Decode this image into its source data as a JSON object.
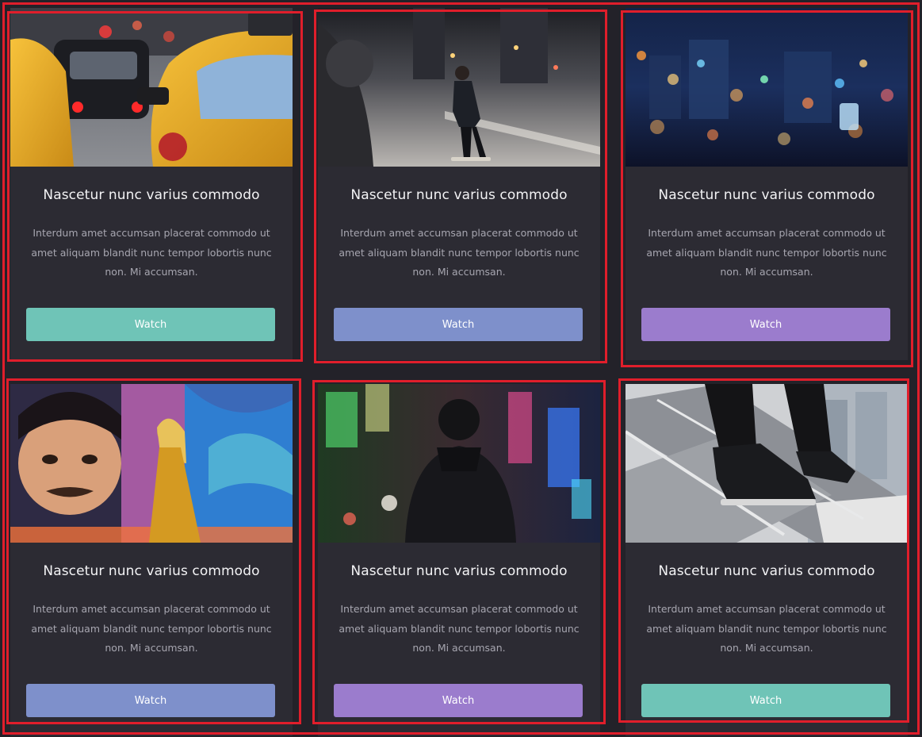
{
  "colors": {
    "background": "#232229",
    "card": "#2c2b33",
    "highlight_frame": "#e01e2b",
    "teal": "#6fc4b7",
    "blue": "#7e90cb",
    "purple": "#9b7ccd"
  },
  "cards": [
    {
      "image": "taxi-traffic-photo",
      "title": "Nascetur nunc varius commodo",
      "text": "Interdum amet accumsan placerat commodo ut amet aliquam blandit nunc tempor lobortis nunc non. Mi accumsan.",
      "button": "Watch",
      "button_color": "#6fc4b7"
    },
    {
      "image": "skateboarder-street-photo",
      "title": "Nascetur nunc varius commodo",
      "text": "Interdum amet accumsan placerat commodo ut amet aliquam blandit nunc tempor lobortis nunc non. Mi accumsan.",
      "button": "Watch",
      "button_color": "#7e90cb"
    },
    {
      "image": "city-lights-bokeh-photo",
      "title": "Nascetur nunc varius commodo",
      "text": "Interdum amet accumsan placerat commodo ut amet aliquam blandit nunc tempor lobortis nunc non. Mi accumsan.",
      "button": "Watch",
      "button_color": "#9b7ccd"
    },
    {
      "image": "woman-mural-photo",
      "title": "Nascetur nunc varius commodo",
      "text": "Interdum amet accumsan placerat commodo ut amet aliquam blandit nunc tempor lobortis nunc non. Mi accumsan.",
      "button": "Watch",
      "button_color": "#7e90cb"
    },
    {
      "image": "man-neon-street-photo",
      "title": "Nascetur nunc varius commodo",
      "text": "Interdum amet accumsan placerat commodo ut amet aliquam blandit nunc tempor lobortis nunc non. Mi accumsan.",
      "button": "Watch",
      "button_color": "#9b7ccd"
    },
    {
      "image": "sneakers-stairs-photo",
      "title": "Nascetur nunc varius commodo",
      "text": "Interdum amet accumsan placerat commodo ut amet aliquam blandit nunc tempor lobortis nunc non. Mi accumsan.",
      "button": "Watch",
      "button_color": "#6fc4b7"
    }
  ]
}
